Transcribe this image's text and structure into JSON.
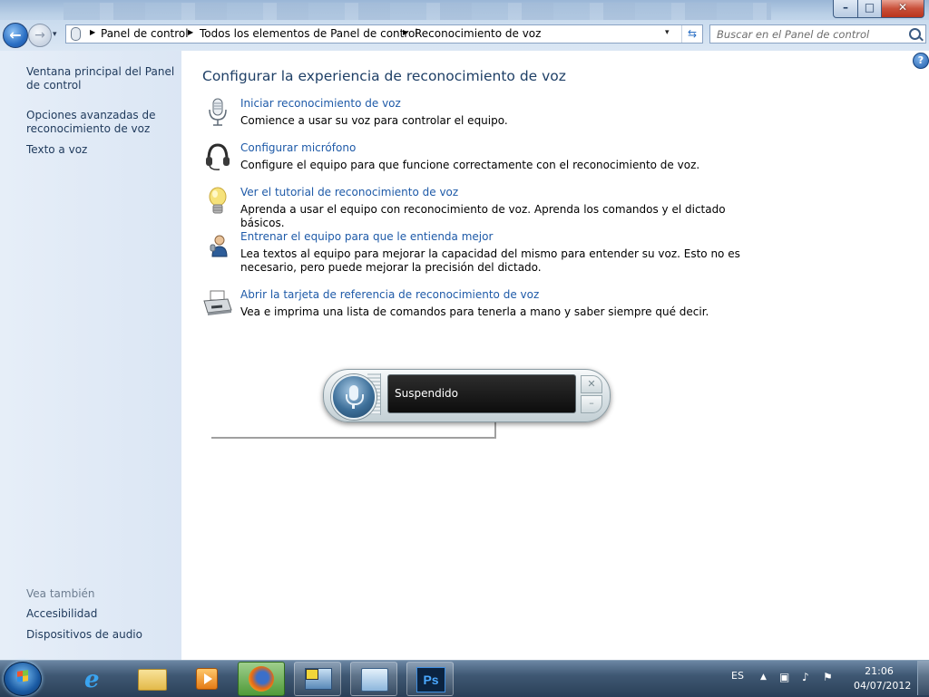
{
  "window": {
    "min_glyph": "–",
    "max_glyph": "□",
    "close_glyph": "✕"
  },
  "nav": {
    "back_glyph": "←",
    "forward_glyph": "→",
    "dropdown_glyph": "▾",
    "crumb_arrow": "▶",
    "breadcrumbs": [
      "Panel de control",
      "Todos los elementos de Panel de control",
      "Reconocimiento de voz"
    ],
    "refresh_glyph": "⇆",
    "search_placeholder": "Buscar en el Panel de control"
  },
  "sidebar": {
    "links": [
      "Ventana principal del Panel de control",
      "Opciones avanzadas de reconocimiento de voz",
      "Texto a voz"
    ],
    "see_also_header": "Vea también",
    "see_also": [
      "Accesibilidad",
      "Dispositivos de audio"
    ]
  },
  "main": {
    "help_glyph": "?",
    "title": "Configurar la experiencia de reconocimiento de voz",
    "tasks": [
      {
        "icon": "microphone-icon",
        "link": "Iniciar reconocimiento de voz",
        "desc": "Comience a usar su voz para controlar el equipo."
      },
      {
        "icon": "headset-icon",
        "link": "Configurar micrófono",
        "desc": "Configure el equipo para que funcione correctamente con el reconocimiento de voz."
      },
      {
        "icon": "lightbulb-icon",
        "link": "Ver el tutorial de reconocimiento de voz",
        "desc": "Aprenda a usar el equipo con reconocimiento de voz. Aprenda los comandos y el dictado básicos."
      },
      {
        "icon": "user-training-icon",
        "link": "Entrenar el equipo para que le entienda mejor",
        "desc": "Lea textos al equipo para mejorar la capacidad del mismo para entender su voz. Esto no es necesario, pero puede mejorar la precisión del dictado."
      },
      {
        "icon": "printer-icon",
        "link": "Abrir la tarjeta de referencia de reconocimiento de voz",
        "desc": "Vea e imprima una lista de comandos para tenerla a mano y saber siempre qué decir."
      }
    ]
  },
  "speech_widget": {
    "status": "Suspendido",
    "close_glyph": "✕",
    "min_glyph": "–"
  },
  "taskbar": {
    "ps_label": "Ps",
    "language": "ES",
    "tray_glyphs": [
      "▲",
      "▣",
      "♪",
      "⚑"
    ],
    "time": "21:06",
    "date": "04/07/2012"
  }
}
